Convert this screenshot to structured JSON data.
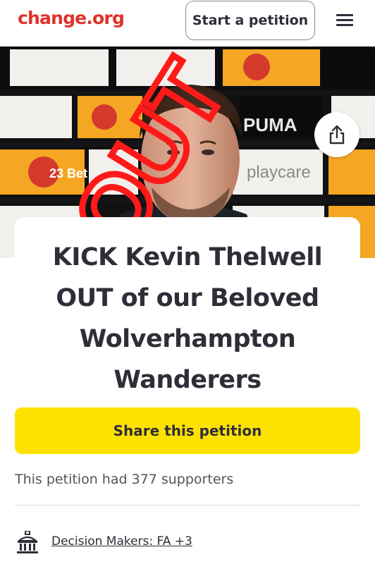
{
  "header": {
    "logo": "change.org",
    "start_button": "Start a petition",
    "menu_icon": "hamburger-menu-icon"
  },
  "hero": {
    "overlay_text": "OUT",
    "banner_text": [
      "PUMA",
      "playcare",
      "23 Bet"
    ],
    "share_icon": "share-icon"
  },
  "petition": {
    "title_lines": [
      "KICK Kevin Thelwell",
      "OUT of our Beloved",
      "Wolverhampton",
      "Wanderers"
    ],
    "share_button": "Share this petition",
    "supporters_text": "This petition had 377 supporters",
    "decision_makers": "Decision Makers: FA +3",
    "decision_icon": "government-building-icon"
  },
  "colors": {
    "brand": "#e0322b",
    "share_button_bg": "#fde200",
    "text": "#2f2e38"
  }
}
